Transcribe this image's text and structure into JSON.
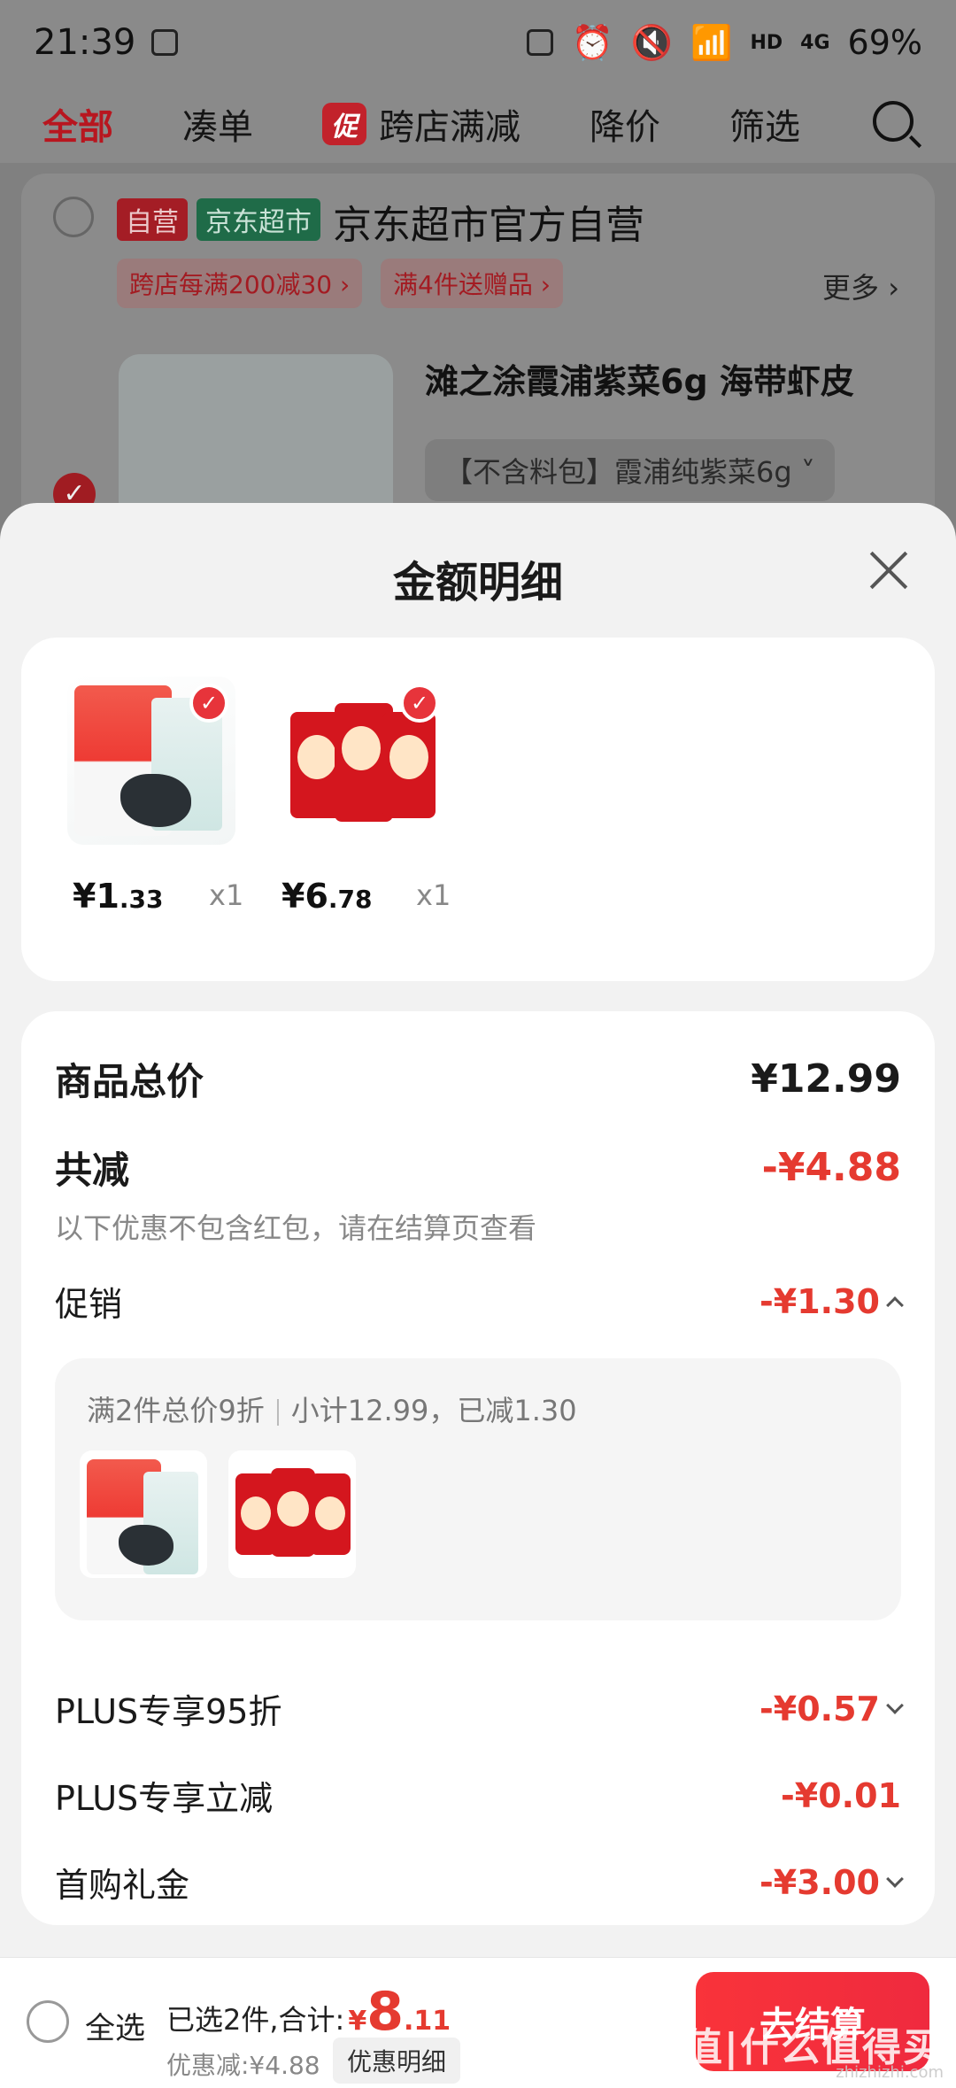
{
  "status_bar": {
    "time": "21:39",
    "network": "HD",
    "signal": "4G",
    "battery": "69%"
  },
  "tabs": [
    {
      "label": "全部",
      "active": true
    },
    {
      "label": "凑单"
    },
    {
      "label": "跨店满减",
      "badge": "促"
    },
    {
      "label": "降价"
    },
    {
      "label": "筛选"
    }
  ],
  "store": {
    "tag_self": "自营",
    "tag_market": "京东超市",
    "name": "京东超市官方自营",
    "promos": [
      "跨店每满200减30 ›",
      "满4件送赠品 ›"
    ],
    "more": "更多 ›"
  },
  "background_product": {
    "title": "滩之涂霞浦紫菜6g 海带虾皮",
    "spec": "【不含料包】霞浦纯紫菜6g ˅"
  },
  "sheet": {
    "title": "金额明细",
    "items": [
      {
        "price_int": "¥1",
        "price_dec": ".33",
        "qty": "x1"
      },
      {
        "price_int": "¥6",
        "price_dec": ".78",
        "qty": "x1"
      }
    ],
    "goods_total_label": "商品总价",
    "goods_total": "¥12.99",
    "reduce_label": "共减",
    "reduce_total": "-¥4.88",
    "reduce_note": "以下优惠不包含红包，请在结算页查看",
    "promo_label": "促销",
    "promo_amount": "-¥1.30",
    "promo_rule": "满2件总价9折",
    "promo_sub": "小计12.99，已减1.30",
    "plus95_label": "PLUS专享95折",
    "plus95_amount": "-¥0.57",
    "plus_cut_label": "PLUS专享立减",
    "plus_cut_amount": "-¥0.01",
    "first_buy_label": "首购礼金",
    "first_buy_amount": "-¥3.00"
  },
  "bottom": {
    "select_all": "全选",
    "selected_text": "已选2件,合计:",
    "total_symbol": "¥",
    "total_int": "8",
    "total_dec": ".11",
    "saved": "优惠减:¥4.88",
    "detail_btn": "优惠明细",
    "checkout": "去结算"
  },
  "watermark": {
    "main": "值|什么值得买",
    "sub": "zhizhizhi.com"
  },
  "colors": {
    "accent": "#e53a30",
    "checkout": "#f9333a",
    "overlay": "#808080"
  }
}
